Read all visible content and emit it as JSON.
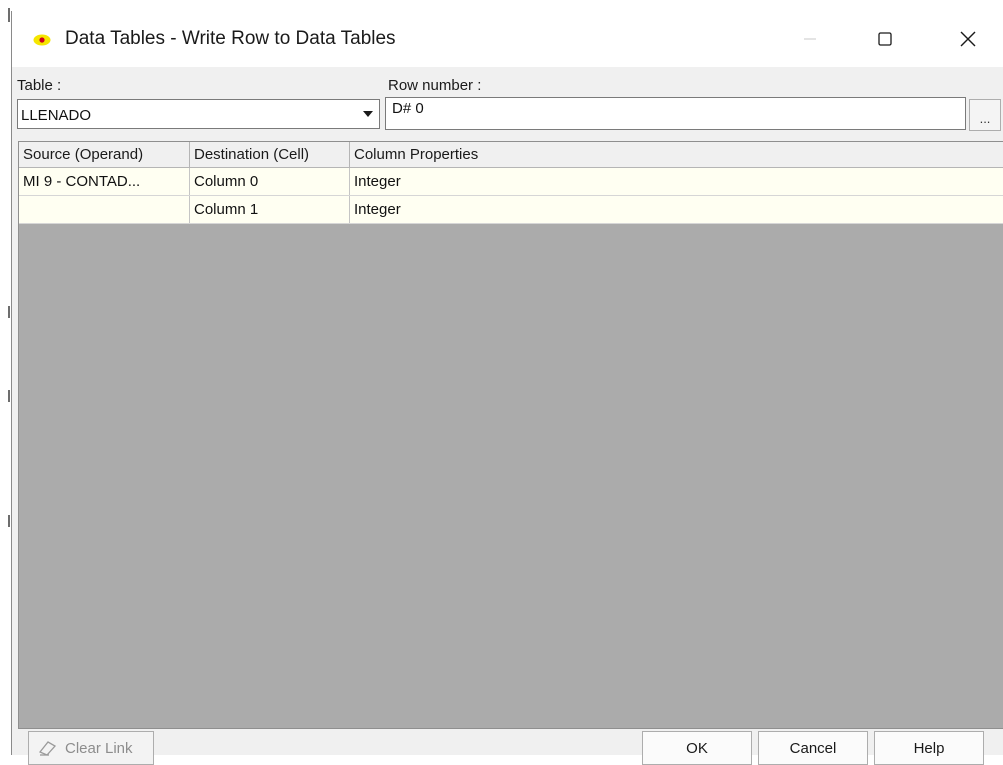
{
  "window": {
    "title": "Data Tables - Write Row to Data Tables"
  },
  "form": {
    "table_label": "Table :",
    "table_value": "LLENADO",
    "row_number_label": "Row number :",
    "row_number_value": "D# 0",
    "browse_label": "..."
  },
  "grid": {
    "columns": [
      "Source (Operand)",
      "Destination (Cell)",
      "Column Properties"
    ],
    "rows": [
      {
        "source": "MI 9  - CONTAD...",
        "destination": "Column 0",
        "properties": "Integer"
      },
      {
        "source": "",
        "destination": "Column 1",
        "properties": "Integer"
      }
    ]
  },
  "buttons": {
    "clear_link": "Clear Link",
    "ok": "OK",
    "cancel": "Cancel",
    "help": "Help"
  },
  "colors": {
    "row_background": "#fffff2",
    "grid_empty_area": "#ababab",
    "icon_yellow": "#f5e600",
    "icon_red": "#d0021b"
  },
  "icons": {
    "app": "data-table-app-icon",
    "minimize": "minimize-icon",
    "maximize": "maximize-icon",
    "close": "close-icon",
    "dropdown": "dropdown-arrow-icon",
    "clear_link": "eraser-icon"
  }
}
